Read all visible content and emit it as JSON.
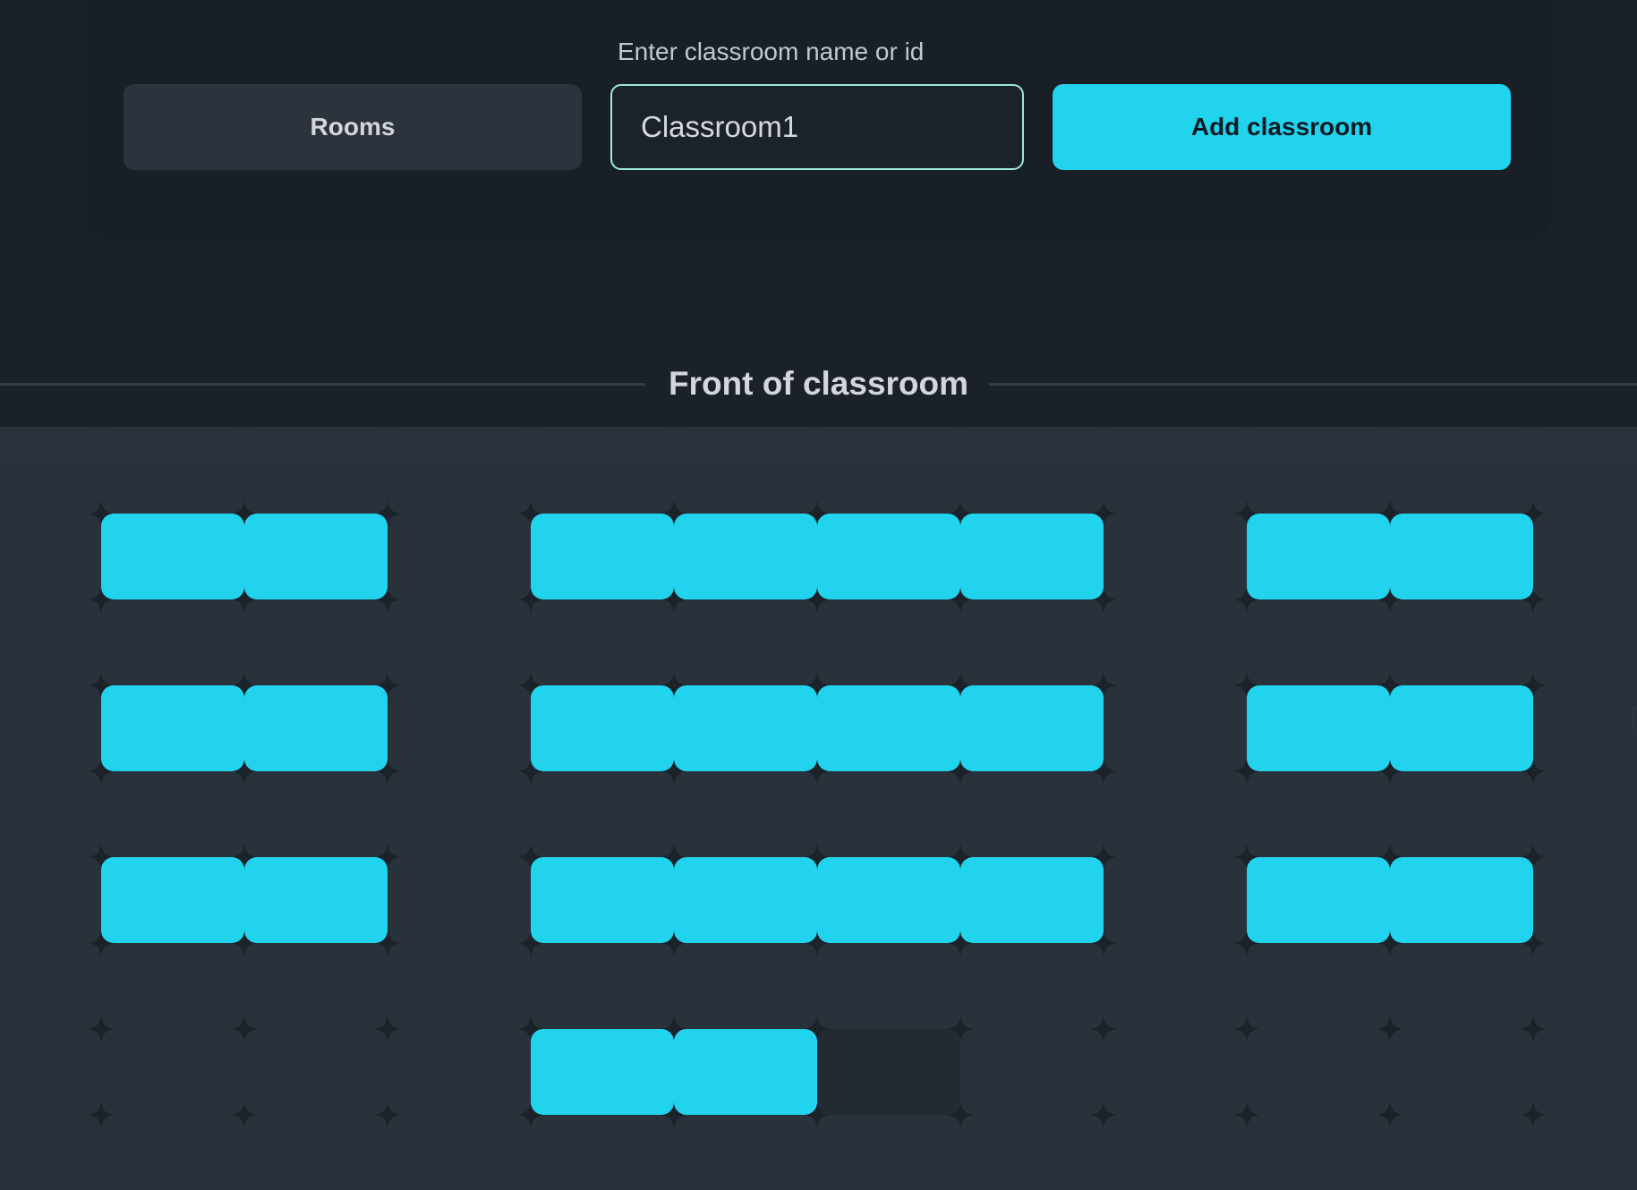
{
  "toolbar": {
    "field_label": "Enter classroom name or id",
    "rooms_label": "Rooms",
    "classroom_value": "Classroom1",
    "classroom_placeholder": "Enter classroom name or id",
    "add_label": "Add classroom"
  },
  "classroom": {
    "front_label": "Front of classroom"
  },
  "colors": {
    "accent": "#22d3ee",
    "background": "#1b2129",
    "floor": "#29313b",
    "input_border": "#9ee8e0"
  },
  "seating": {
    "columns": 11,
    "rows": 4,
    "seats": [
      {
        "row": 1,
        "col": 1,
        "state": "occupied"
      },
      {
        "row": 1,
        "col": 2,
        "state": "occupied"
      },
      {
        "row": 1,
        "col": 4,
        "state": "occupied"
      },
      {
        "row": 1,
        "col": 5,
        "state": "occupied"
      },
      {
        "row": 1,
        "col": 6,
        "state": "occupied"
      },
      {
        "row": 1,
        "col": 7,
        "state": "occupied"
      },
      {
        "row": 1,
        "col": 9,
        "state": "occupied"
      },
      {
        "row": 1,
        "col": 10,
        "state": "occupied"
      },
      {
        "row": 2,
        "col": 1,
        "state": "occupied"
      },
      {
        "row": 2,
        "col": 2,
        "state": "occupied"
      },
      {
        "row": 2,
        "col": 4,
        "state": "occupied"
      },
      {
        "row": 2,
        "col": 5,
        "state": "occupied"
      },
      {
        "row": 2,
        "col": 6,
        "state": "occupied"
      },
      {
        "row": 2,
        "col": 7,
        "state": "occupied"
      },
      {
        "row": 2,
        "col": 9,
        "state": "occupied"
      },
      {
        "row": 2,
        "col": 10,
        "state": "occupied"
      },
      {
        "row": 3,
        "col": 1,
        "state": "occupied"
      },
      {
        "row": 3,
        "col": 2,
        "state": "occupied"
      },
      {
        "row": 3,
        "col": 4,
        "state": "occupied"
      },
      {
        "row": 3,
        "col": 5,
        "state": "occupied"
      },
      {
        "row": 3,
        "col": 6,
        "state": "occupied"
      },
      {
        "row": 3,
        "col": 7,
        "state": "occupied"
      },
      {
        "row": 3,
        "col": 9,
        "state": "occupied"
      },
      {
        "row": 3,
        "col": 10,
        "state": "occupied"
      },
      {
        "row": 4,
        "col": 4,
        "state": "occupied"
      },
      {
        "row": 4,
        "col": 5,
        "state": "occupied"
      },
      {
        "row": 4,
        "col": 6,
        "state": "empty"
      }
    ]
  }
}
